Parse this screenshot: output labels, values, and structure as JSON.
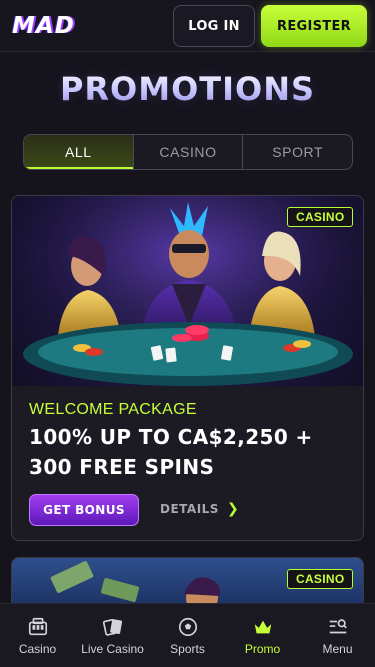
{
  "header": {
    "logo_text": "MAD",
    "login_label": "LOG IN",
    "register_label": "REGISTER"
  },
  "page": {
    "title": "PROMOTIONS"
  },
  "tabs": [
    {
      "label": "ALL",
      "active": true
    },
    {
      "label": "CASINO",
      "active": false
    },
    {
      "label": "SPORT",
      "active": false
    }
  ],
  "promo_cards": [
    {
      "badge": "CASINO",
      "label": "WELCOME PACKAGE",
      "headline": "100% UP TO CA$2,250 + 300 FREE SPINS",
      "cta_label": "GET BONUS",
      "details_label": "DETAILS"
    },
    {
      "badge": "CASINO"
    }
  ],
  "bottom_nav": [
    {
      "label": "Casino",
      "icon": "casino-icon",
      "active": false
    },
    {
      "label": "Live Casino",
      "icon": "cards-icon",
      "active": false
    },
    {
      "label": "Sports",
      "icon": "soccer-ball-icon",
      "active": false
    },
    {
      "label": "Promo",
      "icon": "crown-icon",
      "active": true
    },
    {
      "label": "Menu",
      "icon": "menu-search-icon",
      "active": false
    }
  ],
  "colors": {
    "accent_lime": "#b9ff2e",
    "accent_purple": "#8a2be2",
    "background": "#15131c"
  }
}
